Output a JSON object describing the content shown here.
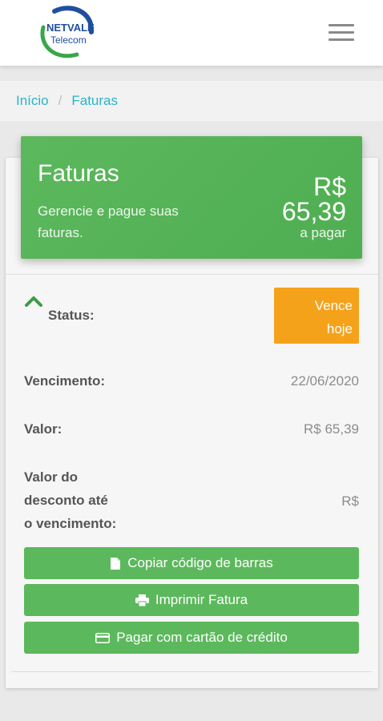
{
  "brand": {
    "logo_line1": "NETVALE",
    "logo_line2": "Telecom"
  },
  "breadcrumb": {
    "home": "Início",
    "separator": "/",
    "current": "Faturas"
  },
  "hero": {
    "title": "Faturas",
    "subtitle": "Gerencie e pague suas faturas.",
    "currency": "R$",
    "amount": "65,39",
    "amount_caption": "a pagar"
  },
  "invoice": {
    "status_label": "Status:",
    "status_value_line1": "Vence",
    "status_value_line2": "hoje",
    "due_label": "Vencimento:",
    "due_value": "22/06/2020",
    "value_label": "Valor:",
    "value_value": "R$ 65,39",
    "discount_label_line1": "Valor do",
    "discount_label_line2": "desconto até",
    "discount_label_line3": "o vencimento:",
    "discount_value": "R$"
  },
  "actions": {
    "copy_barcode": "Copiar código de barras",
    "print_invoice": "Imprimir Fatura",
    "pay_card": "Pagar com cartão de crédito"
  },
  "colors": {
    "green": "#5cb85c",
    "orange": "#f5a21b",
    "link": "#2bb3c8"
  }
}
